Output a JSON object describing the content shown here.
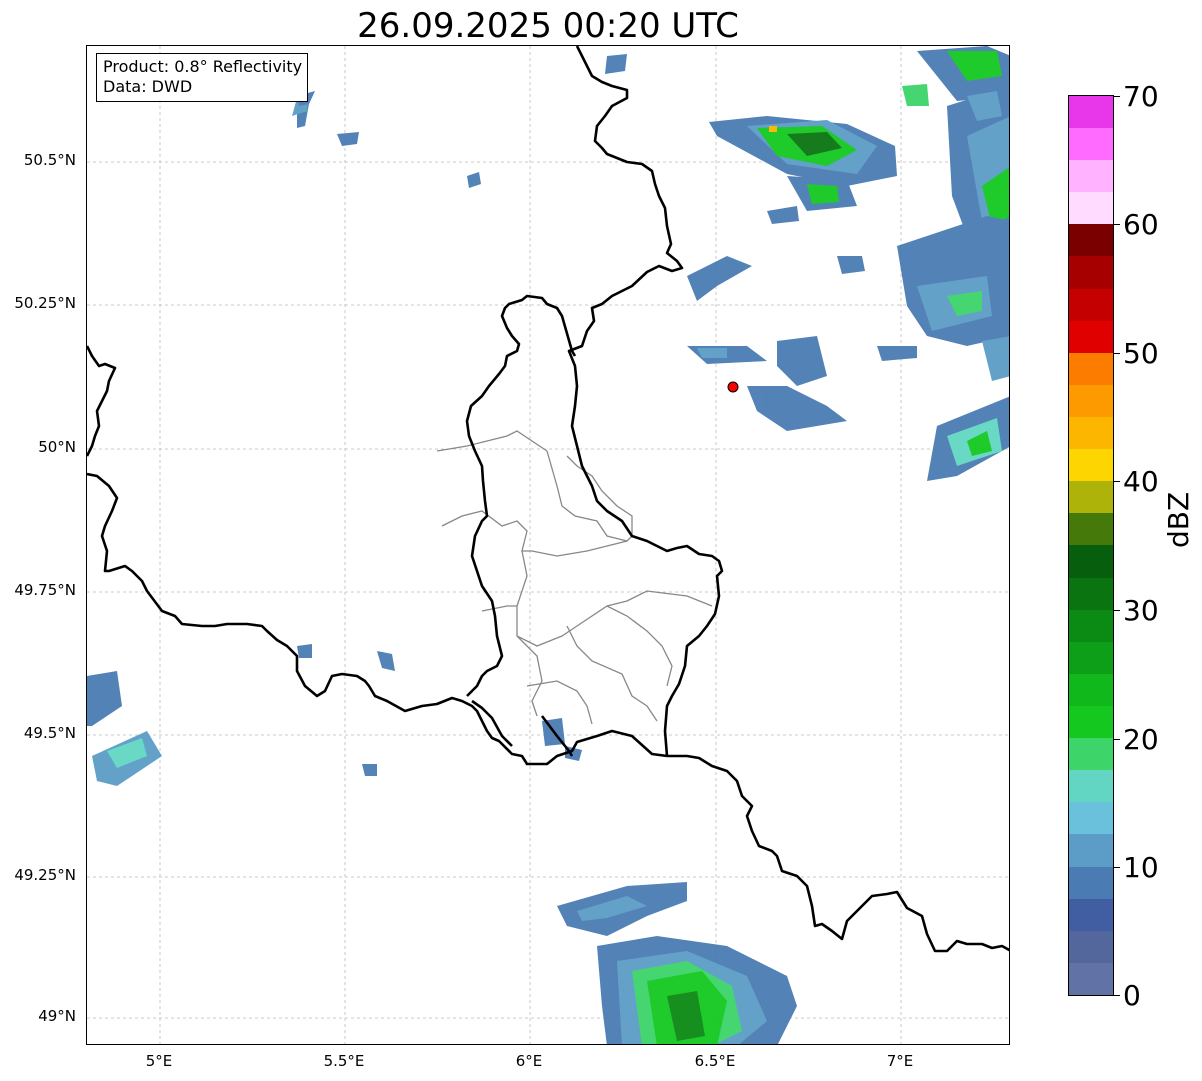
{
  "title": "26.09.2025 00:20 UTC",
  "info_box": {
    "product": "Product: 0.8° Reflectivity",
    "data": "Data: DWD"
  },
  "axes": {
    "lat_labels": [
      "50.5°N",
      "50.25°N",
      "50°N",
      "49.75°N",
      "49.5°N",
      "49.25°N",
      "49°N"
    ],
    "lon_labels": [
      "5°E",
      "5.5°E",
      "6°E",
      "6.5°E",
      "7°E"
    ]
  },
  "colorbar": {
    "unit": "dBZ",
    "tick_labels": [
      "0",
      "10",
      "20",
      "30",
      "40",
      "50",
      "60",
      "70"
    ],
    "colors": [
      "#6172a6",
      "#53679c",
      "#425ea2",
      "#4a7cb3",
      "#5b9dc7",
      "#69c1dc",
      "#62d6c2",
      "#3dd46a",
      "#14c820",
      "#10b81c",
      "#0e9f18",
      "#0b8a14",
      "#0a7410",
      "#075e0c",
      "#457a0a",
      "#aeb30a",
      "#fdd500",
      "#fcb600",
      "#fc9a00",
      "#fc7c00",
      "#e00000",
      "#c40000",
      "#a60000",
      "#7a0000",
      "#ffdcff",
      "#ffb2ff",
      "#ff6bff",
      "#e837ea"
    ]
  },
  "station_marker": {
    "color": "#ff0000",
    "name": "radar-site-marker"
  }
}
